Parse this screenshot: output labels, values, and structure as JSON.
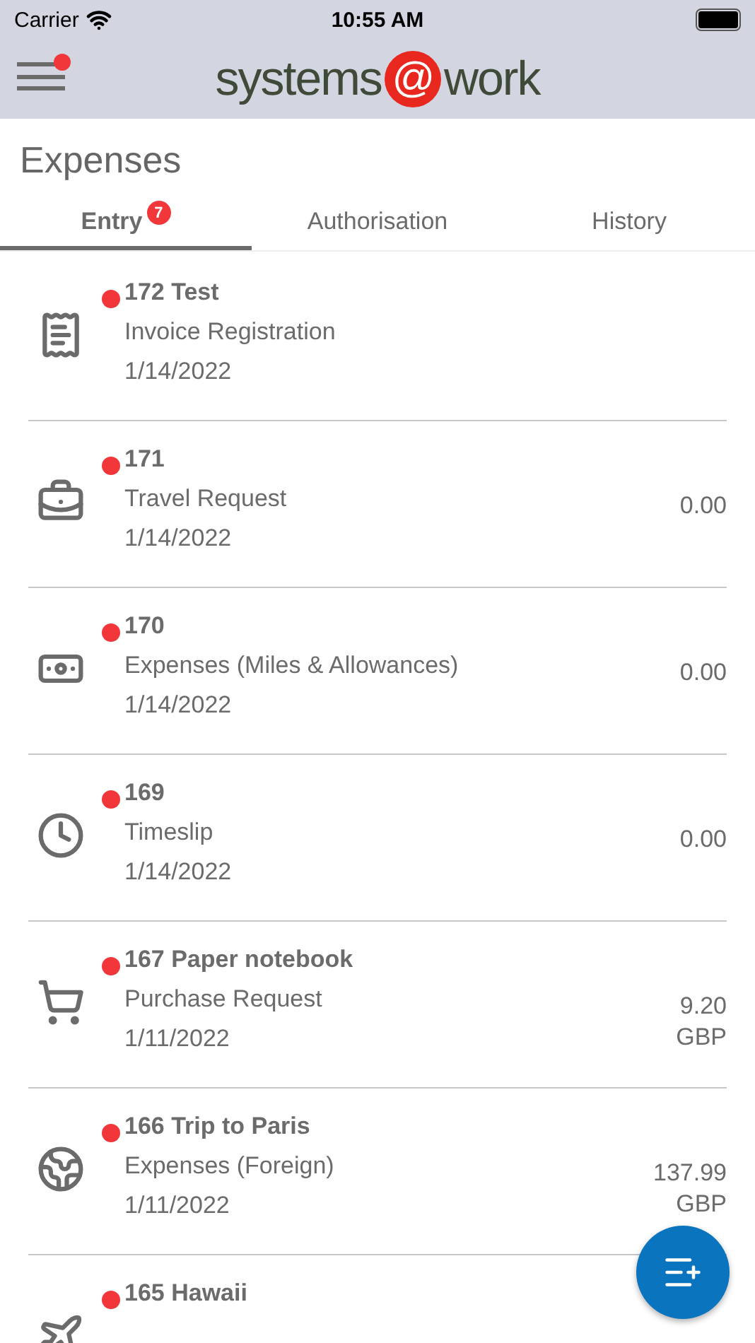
{
  "status_bar": {
    "carrier": "Carrier",
    "time": "10:55 AM"
  },
  "header": {
    "menu_notification": true,
    "logo": {
      "left": "systems",
      "mark": "@",
      "right": "work"
    }
  },
  "page_title": "Expenses",
  "tabs": [
    {
      "label": "Entry",
      "badge": "7",
      "selected": true
    },
    {
      "label": "Authorisation",
      "selected": false
    },
    {
      "label": "History",
      "selected": false
    }
  ],
  "items": [
    {
      "kind": "invoice",
      "title": "172 Test",
      "type": "Invoice Registration",
      "date": "1/14/2022",
      "unread": true
    },
    {
      "kind": "travel",
      "title": "171",
      "type": "Travel Request",
      "date": "1/14/2022",
      "amount": "0.00",
      "unread": true
    },
    {
      "kind": "expenses",
      "title": "170",
      "type": "Expenses (Miles & Allowances)",
      "date": "1/14/2022",
      "amount": "0.00",
      "unread": true
    },
    {
      "kind": "timeslip",
      "title": "169",
      "type": "Timeslip",
      "date": "1/14/2022",
      "amount": "0.00",
      "unread": true
    },
    {
      "kind": "purchase",
      "title": "167 Paper notebook",
      "type": "Purchase Request",
      "date": "1/11/2022",
      "amount": "9.20",
      "currency": "GBP",
      "unread": true
    },
    {
      "kind": "foreign",
      "title": "166 Trip to Paris",
      "type": "Expenses (Foreign)",
      "date": "1/11/2022",
      "amount": "137.99",
      "currency": "GBP",
      "unread": true
    },
    {
      "kind": "plane",
      "title": "165 Hawaii",
      "unread": true
    }
  ]
}
